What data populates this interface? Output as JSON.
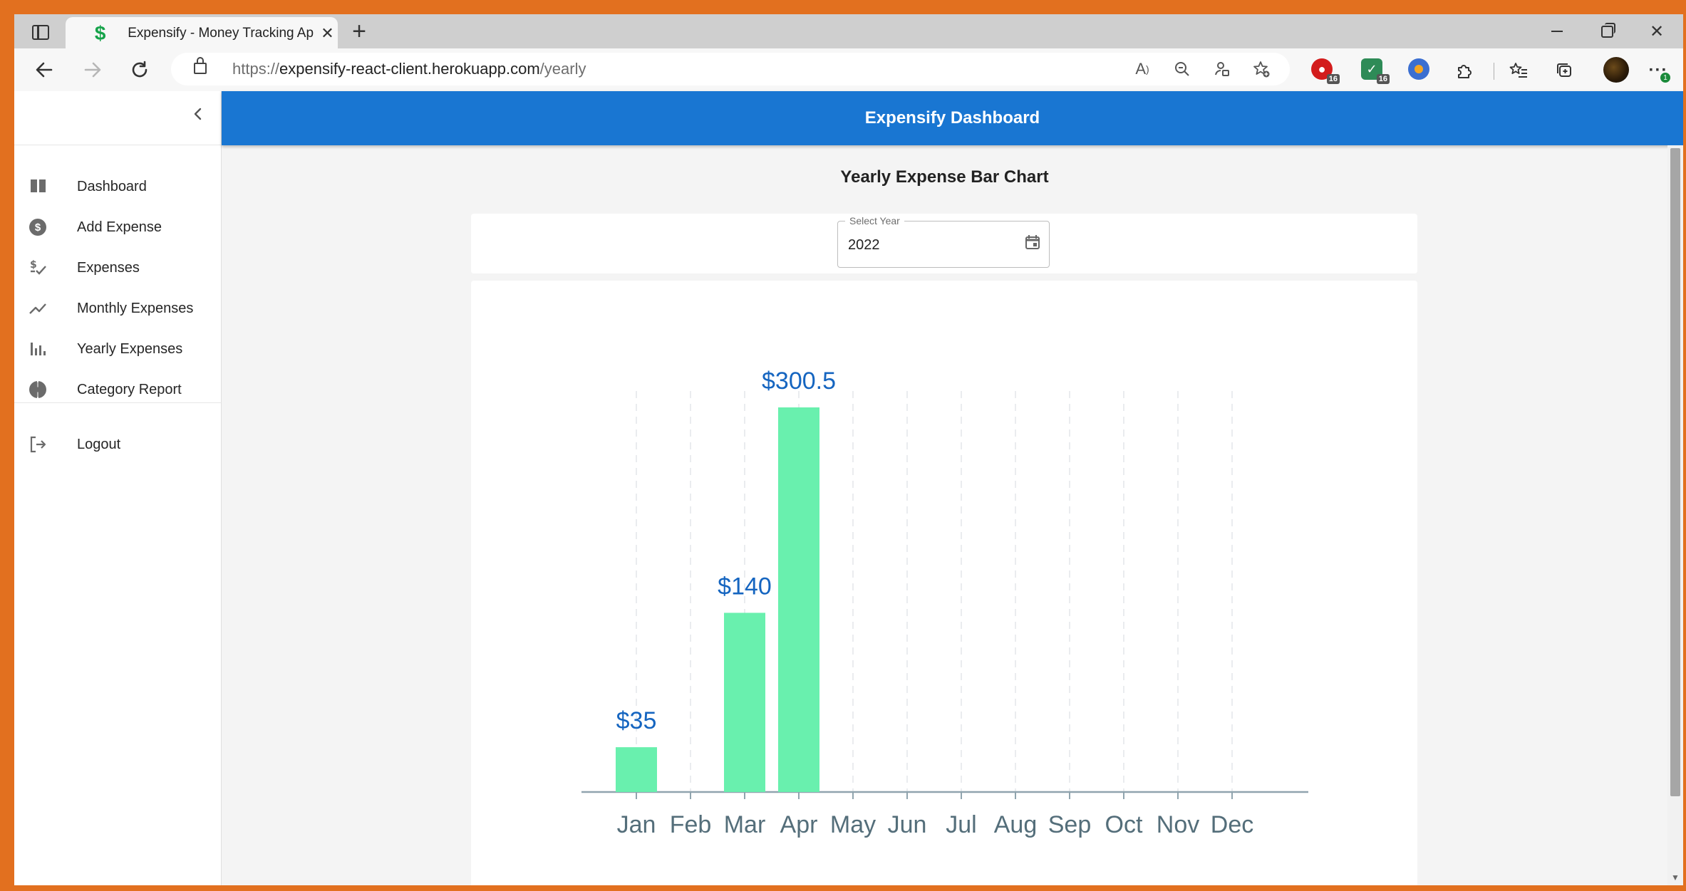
{
  "browser": {
    "tab_title": "Expensify - Money Tracking App",
    "url_prefix": "https://",
    "url_host": "expensify-react-client.herokuapp.com",
    "url_path": "/yearly",
    "extension_badges": [
      "16",
      "16"
    ],
    "update_badge": "1"
  },
  "sidebar": {
    "items": [
      {
        "label": "Dashboard",
        "icon": "dashboard-icon"
      },
      {
        "label": "Add Expense",
        "icon": "dollar-circle-icon"
      },
      {
        "label": "Expenses",
        "icon": "expenses-icon"
      },
      {
        "label": "Monthly Expenses",
        "icon": "trend-line-icon"
      },
      {
        "label": "Yearly Expenses",
        "icon": "bar-chart-icon"
      },
      {
        "label": "Category Report",
        "icon": "pie-chart-icon"
      }
    ],
    "logout": {
      "label": "Logout",
      "icon": "logout-icon"
    }
  },
  "header": {
    "title": "Expensify Dashboard"
  },
  "main": {
    "heading": "Yearly Expense Bar Chart",
    "year_picker": {
      "label": "Select Year",
      "value": "2022"
    }
  },
  "colors": {
    "header": "#1976d2",
    "bar": "#69f0ae",
    "value_label": "#1565c0",
    "tick_label": "#546e7a",
    "axis": "#90a4ae"
  },
  "chart_data": {
    "type": "bar",
    "categories": [
      "Jan",
      "Feb",
      "Mar",
      "Apr",
      "May",
      "Jun",
      "Jul",
      "Aug",
      "Sep",
      "Oct",
      "Nov",
      "Dec"
    ],
    "values": [
      35,
      0,
      140,
      300.5,
      0,
      0,
      0,
      0,
      0,
      0,
      0,
      0
    ],
    "labels": [
      "$35",
      "",
      "$140",
      "$300.5",
      "",
      "",
      "",
      "",
      "",
      "",
      "",
      ""
    ],
    "ylim": [
      0,
      300.5
    ],
    "grid": "vertical dashed",
    "legend": "none"
  }
}
